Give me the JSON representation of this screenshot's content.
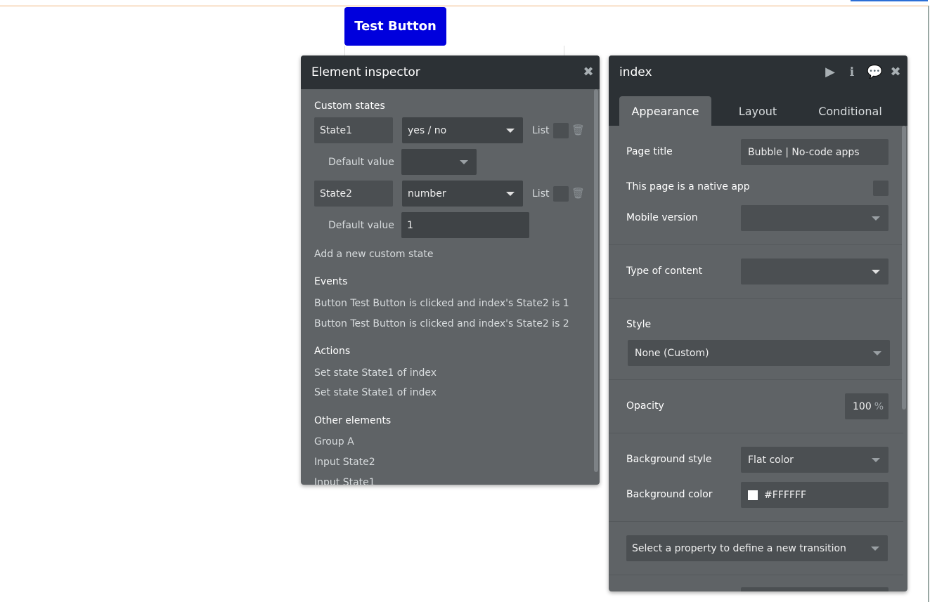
{
  "canvas": {
    "test_button_label": "Test Button"
  },
  "inspector": {
    "title": "Element inspector",
    "close_icon": "close-icon",
    "custom_states_label": "Custom states",
    "states": [
      {
        "name": "State1",
        "type": "yes / no",
        "list_label": "List",
        "default_label": "Default value",
        "default_value": ""
      },
      {
        "name": "State2",
        "type": "number",
        "list_label": "List",
        "default_label": "Default value",
        "default_value": "1"
      }
    ],
    "add_state_label": "Add a new custom state",
    "events_label": "Events",
    "events": [
      "Button Test Button is clicked and index's State2 is 1",
      "Button Test Button is clicked and index's State2 is 2"
    ],
    "actions_label": "Actions",
    "actions": [
      "Set state State1 of index",
      "Set state State1 of index"
    ],
    "other_elements_label": "Other elements",
    "other_elements": [
      "Group A",
      "Input State2",
      "Input State1"
    ]
  },
  "index_panel": {
    "title": "index",
    "header_icons": [
      "play-icon",
      "info-icon",
      "comment-icon",
      "close-icon"
    ],
    "tabs": [
      {
        "label": "Appearance",
        "active": true
      },
      {
        "label": "Layout",
        "active": false
      },
      {
        "label": "Conditional",
        "active": false
      }
    ],
    "page_title_label": "Page title",
    "page_title_value": "Bubble | No-code apps",
    "native_app_label": "This page is a native app",
    "mobile_version_label": "Mobile version",
    "mobile_version_value": "",
    "type_of_content_label": "Type of content",
    "type_of_content_value": "",
    "style_label": "Style",
    "style_value": "None (Custom)",
    "opacity_label": "Opacity",
    "opacity_value": "100",
    "opacity_unit": "%",
    "background_style_label": "Background style",
    "background_style_value": "Flat color",
    "background_color_label": "Background color",
    "background_color_value": "#FFFFFF",
    "transition_placeholder": "Select a property to define a new transition"
  }
}
